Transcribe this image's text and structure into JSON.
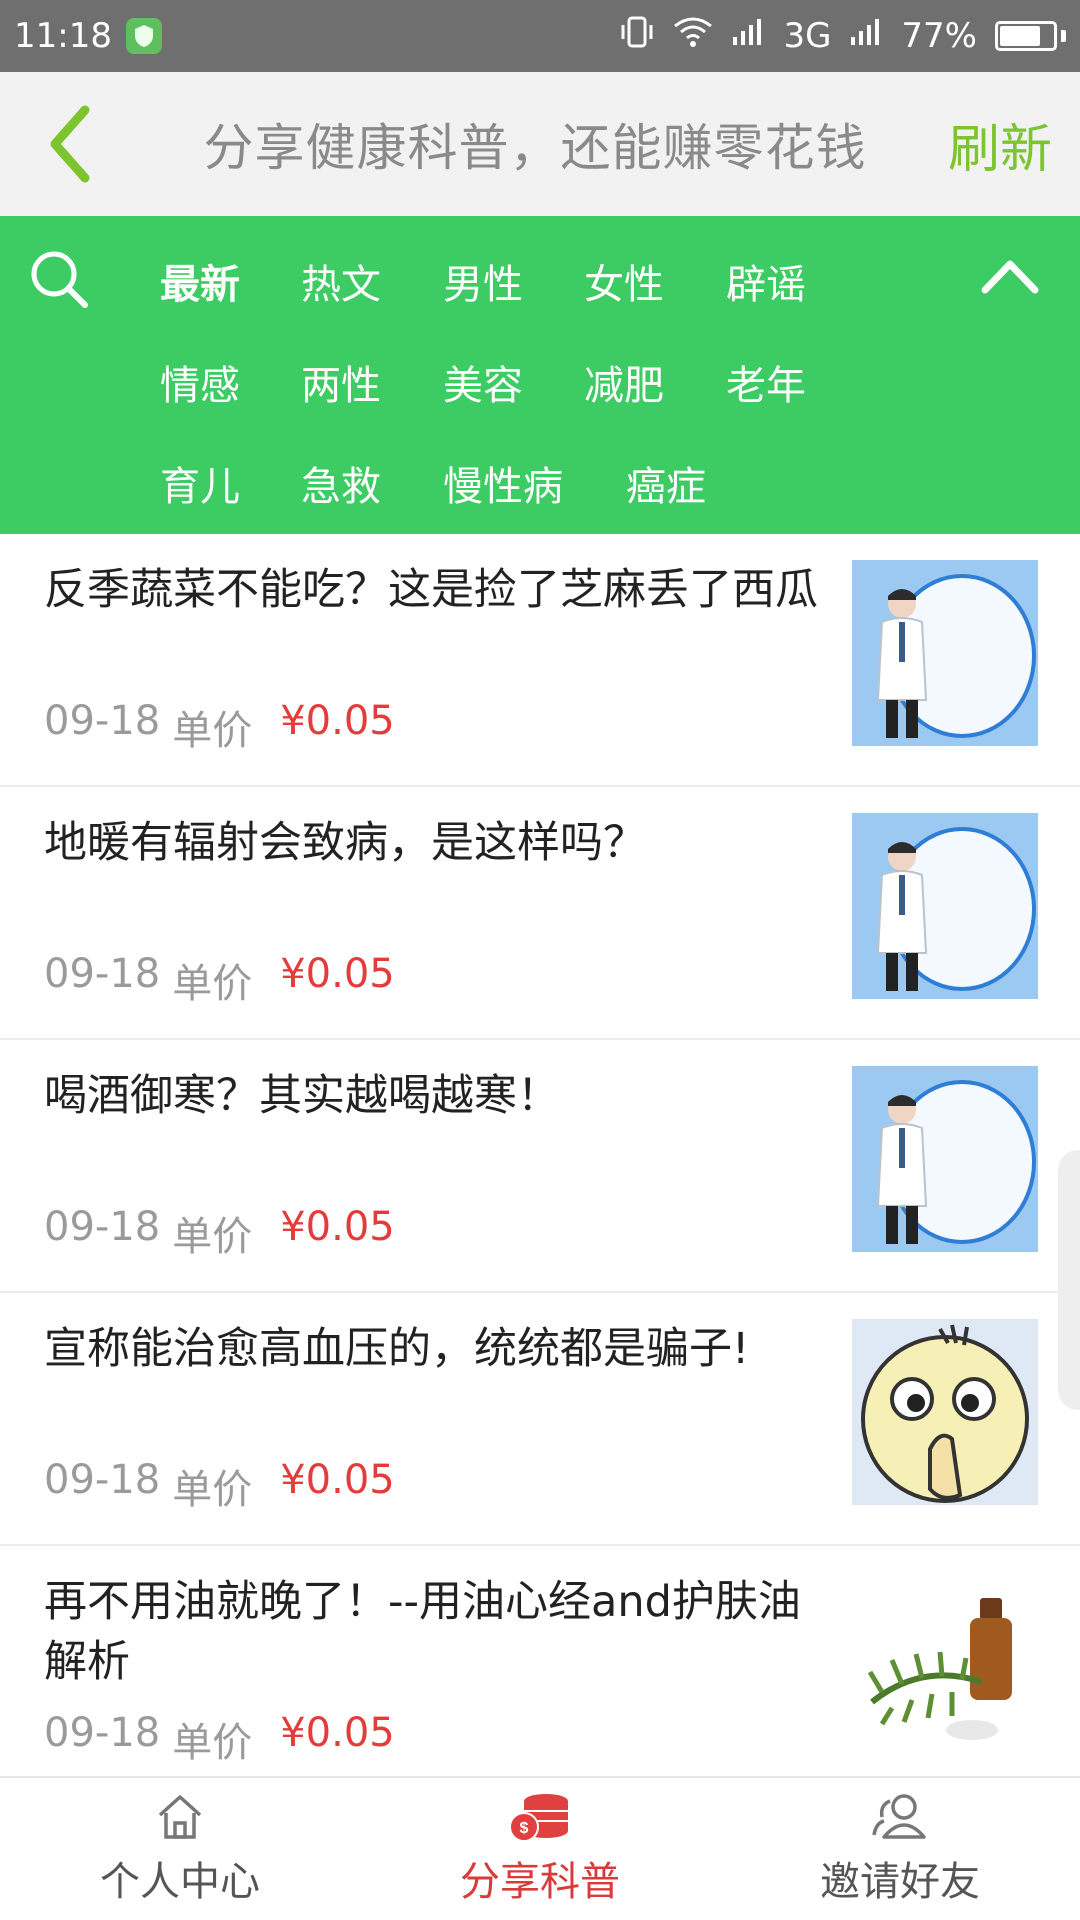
{
  "status_bar": {
    "time": "11:18",
    "network": "3G",
    "battery": "77%",
    "battery_level": 0.77
  },
  "header": {
    "title": "分享健康科普，还能赚零花钱",
    "refresh_label": "刷新"
  },
  "categories": [
    "最新",
    "热文",
    "男性",
    "女性",
    "辟谣",
    "情感",
    "两性",
    "美容",
    "减肥",
    "老年",
    "育儿",
    "急救",
    "慢性病",
    "癌症"
  ],
  "active_category": "最新",
  "articles": [
    {
      "title": "反季蔬菜不能吃？这是捡了芝麻丢了西瓜",
      "date": "09-18",
      "price_label": "单价",
      "price": "¥0.05",
      "thumb": "doctor"
    },
    {
      "title": "地暖有辐射会致病，是这样吗？",
      "date": "09-18",
      "price_label": "单价",
      "price": "¥0.05",
      "thumb": "doctor"
    },
    {
      "title": "喝酒御寒？其实越喝越寒！",
      "date": "09-18",
      "price_label": "单价",
      "price": "¥0.05",
      "thumb": "doctor"
    },
    {
      "title": "宣称能治愈高血压的，统统都是骗子!",
      "date": "09-18",
      "price_label": "单价",
      "price": "¥0.05",
      "thumb": "shush-face"
    },
    {
      "title": "再不用油就晚了！--用油心经and护肤油解析",
      "date": "09-18",
      "price_label": "单价",
      "price": "¥0.05",
      "thumb": "essential-oil"
    }
  ],
  "bottom_nav": [
    {
      "label": "个人中心",
      "icon": "home-icon",
      "active": false
    },
    {
      "label": "分享科普",
      "icon": "coins-icon",
      "active": true
    },
    {
      "label": "邀请好友",
      "icon": "users-icon",
      "active": false
    }
  ],
  "colors": {
    "accent_green": "#3dcb63",
    "refresh_green": "#7dc52e",
    "price_red": "#e43b3b",
    "active_nav_red": "#d93a3a"
  }
}
